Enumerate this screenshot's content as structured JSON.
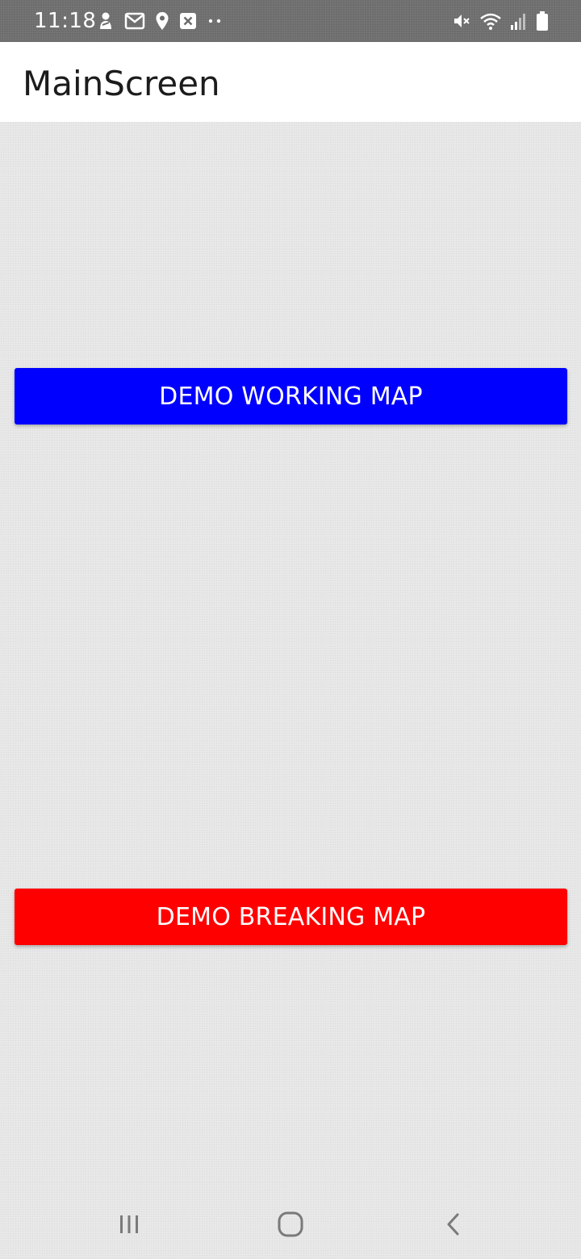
{
  "status_bar": {
    "time": "11:18",
    "left_icons": [
      "person-notification-icon",
      "gmail-icon",
      "location-icon",
      "close-box-icon",
      "more-dots-icon"
    ],
    "right_icons": [
      "mute-icon",
      "wifi-icon",
      "signal-icon",
      "battery-icon"
    ]
  },
  "app_bar": {
    "title": "MainScreen"
  },
  "buttons": {
    "working_label": "DEMO WORKING MAP",
    "working_color": "#0000ff",
    "breaking_label": "DEMO BREAKING MAP",
    "breaking_color": "#ff0000"
  },
  "nav_bar": {
    "buttons": [
      "recents-icon",
      "home-icon",
      "back-icon"
    ]
  }
}
